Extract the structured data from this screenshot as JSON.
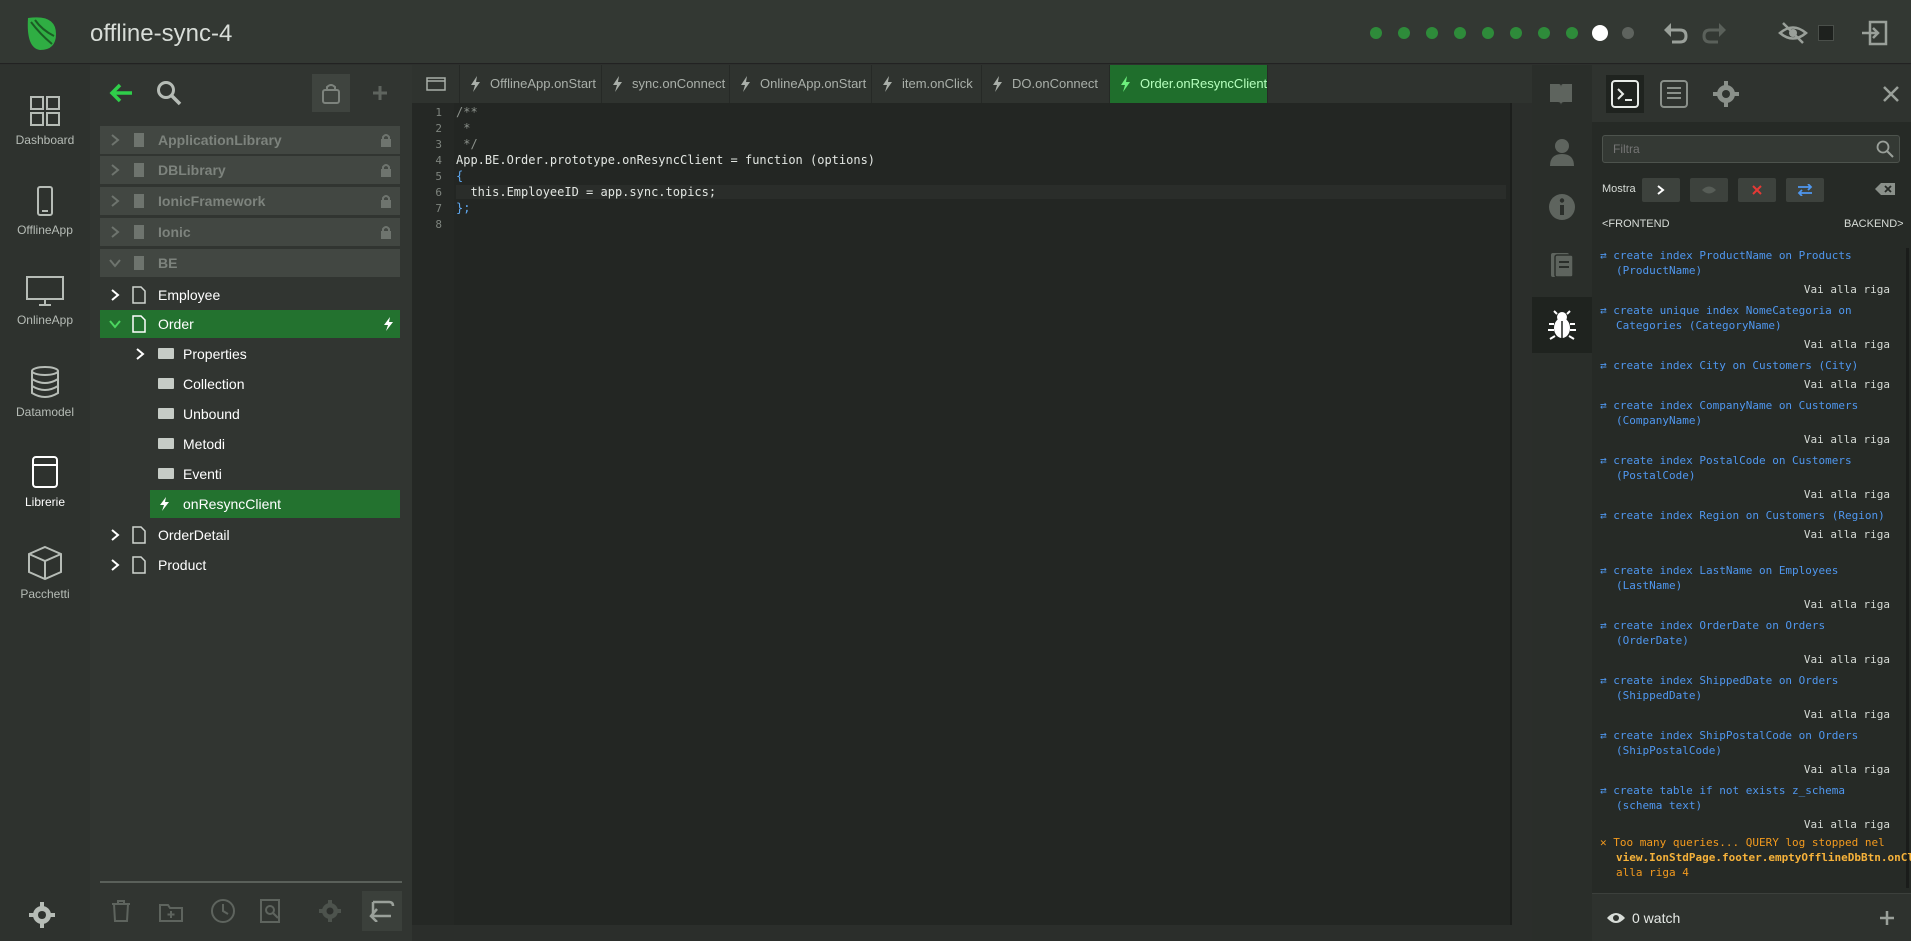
{
  "app": {
    "title": "offline-sync-4"
  },
  "leftnav": {
    "items": [
      {
        "label": "Dashboard",
        "icon": "dashboard-icon"
      },
      {
        "label": "OfflineApp",
        "icon": "phone-icon"
      },
      {
        "label": "OnlineApp",
        "icon": "monitor-icon"
      },
      {
        "label": "Datamodel",
        "icon": "database-icon"
      },
      {
        "label": "Librerie",
        "icon": "book-icon"
      },
      {
        "label": "Pacchetti",
        "icon": "package-icon"
      }
    ]
  },
  "explorer": {
    "tree": [
      {
        "label": "ApplicationLibrary"
      },
      {
        "label": "DBLibrary"
      },
      {
        "label": "IonicFramework"
      },
      {
        "label": "Ionic"
      },
      {
        "label": "BE"
      },
      {
        "label": "Employee"
      },
      {
        "label": "Order"
      },
      {
        "label": "Properties"
      },
      {
        "label": "Collection"
      },
      {
        "label": "Unbound"
      },
      {
        "label": "Metodi"
      },
      {
        "label": "Eventi"
      },
      {
        "label": "onResyncClient"
      },
      {
        "label": "OrderDetail"
      },
      {
        "label": "Product"
      }
    ]
  },
  "editor": {
    "tabs": [
      {
        "label": "OfflineApp.onStart"
      },
      {
        "label": "sync.onConnect"
      },
      {
        "label": "OnlineApp.onStart"
      },
      {
        "label": "item.onClick"
      },
      {
        "label": "DO.onConnect"
      },
      {
        "label": "Order.onResyncClient"
      }
    ],
    "line_numbers": [
      "1",
      "2",
      "3",
      "4",
      "5",
      "6",
      "7",
      "8"
    ],
    "code": [
      "/**",
      " *",
      " */",
      "App.BE.Order.prototype.onResyncClient = function (options)",
      "{",
      "  this.EmployeeID = app.sync.topics;",
      "};",
      ""
    ]
  },
  "console": {
    "filter_placeholder": "Filtra",
    "show_label": "Mostra",
    "frontend_label": "<FRONTEND",
    "backend_label": "BACKEND>",
    "goto_label": "Vai alla riga",
    "entries": [
      "create index ProductName on Products (ProductName)",
      "create unique index NomeCategoria on Categories (CategoryName)",
      "create index City on Customers (City)",
      "create index CompanyName on Customers (CompanyName)",
      "create index PostalCode on Customers (PostalCode)",
      "create index Region on Customers (Region)",
      "create index LastName on Employees (LastName)",
      "create index OrderDate on Orders (OrderDate)",
      "create index ShippedDate on Orders (ShippedDate)",
      "create index ShipPostalCode on Orders (ShipPostalCode)",
      "create table if not exists z_schema (schema text)"
    ],
    "warning_prefix": "Too many queries... QUERY log stopped nel ",
    "warning_location": "view.IonStdPage.footer.emptyOfflineDbBtn.onClick",
    "warning_suffix": " alla riga 4",
    "watch_label": "0 watch"
  },
  "colors": {
    "accent": "#23722f",
    "query": "#4f97ef",
    "warning": "#f39a1e"
  }
}
